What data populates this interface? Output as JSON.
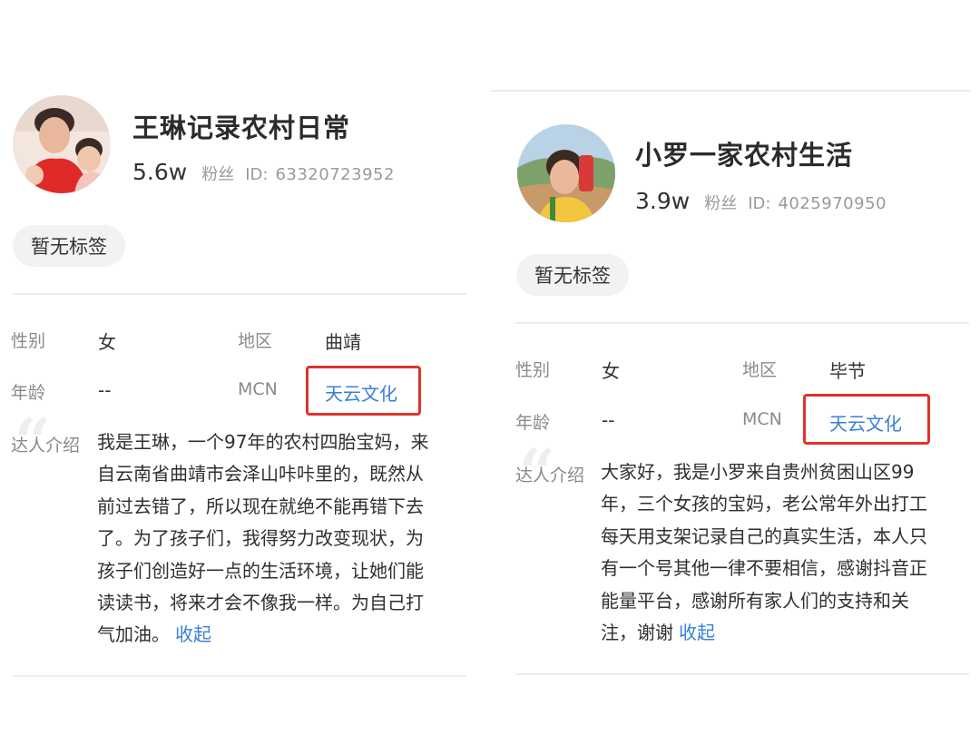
{
  "profiles": [
    {
      "name": "王琳记录农村日常",
      "fans_count": "5.6w",
      "fans_label": "粉丝",
      "id_label": "ID:",
      "id_value": "63320723952",
      "tag": "暂无标签",
      "gender_label": "性别",
      "gender_value": "女",
      "region_label": "地区",
      "region_value": "曲靖",
      "age_label": "年龄",
      "age_value": "--",
      "mcn_label": "MCN",
      "mcn_value": "天云文化",
      "intro_label": "达人介绍",
      "intro_lines": [
        "我是王琳，一个97年的农村四胎宝妈，来",
        "自云南省曲靖市会泽山咔咔里的，既然从",
        "前过去错了，所以现在就绝不能再错下去",
        "了。为了孩子们，我得努力改变现状，为",
        "孩子们创造好一点的生活环境，让她们能",
        "读读书，将来才会不像我一样。为自己打",
        "气加油。"
      ],
      "collapse_label": "收起"
    },
    {
      "name": "小罗一家农村生活",
      "fans_count": "3.9w",
      "fans_label": "粉丝",
      "id_label": "ID:",
      "id_value": "4025970950",
      "tag": "暂无标签",
      "gender_label": "性别",
      "gender_value": "女",
      "region_label": "地区",
      "region_value": "毕节",
      "age_label": "年龄",
      "age_value": "--",
      "mcn_label": "MCN",
      "mcn_value": "天云文化",
      "intro_label": "达人介绍",
      "intro_lines": [
        "大家好，我是小罗来自贵州贫困山区99",
        "年，三个女孩的宝妈，老公常年外出打工",
        "每天用支架记录自己的真实生活，本人只",
        "有一个号其他一律不要相信，感谢抖音正",
        "能量平台，感谢所有家人们的支持和关",
        "注，谢谢"
      ],
      "collapse_label": "收起"
    }
  ],
  "colors": {
    "link": "#3a7fd5",
    "highlight_border": "#e0322b",
    "tag_bg": "#f2f2f2"
  }
}
